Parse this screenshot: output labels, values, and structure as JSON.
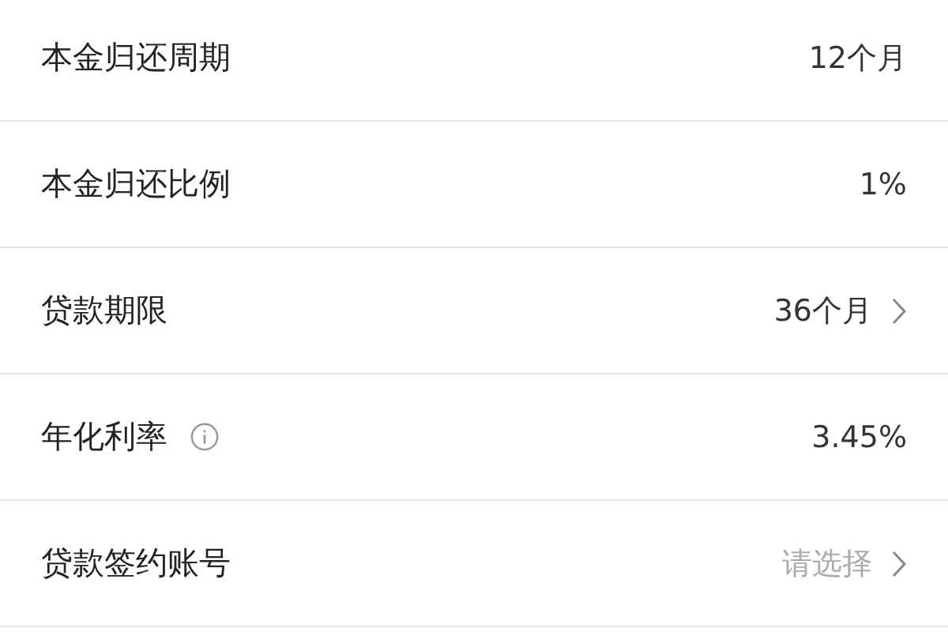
{
  "rows": [
    {
      "label": "本金归还周期",
      "value": "12个月",
      "info": false,
      "chevron": false
    },
    {
      "label": "本金归还比例",
      "value": "1%",
      "info": false,
      "chevron": false
    },
    {
      "label": "贷款期限",
      "value": "36个月",
      "info": false,
      "chevron": true
    },
    {
      "label": "年化利率",
      "value": "3.45%",
      "info": true,
      "chevron": false
    },
    {
      "label": "贷款签约账号",
      "placeholder": "请选择",
      "info": false,
      "chevron": true
    }
  ]
}
